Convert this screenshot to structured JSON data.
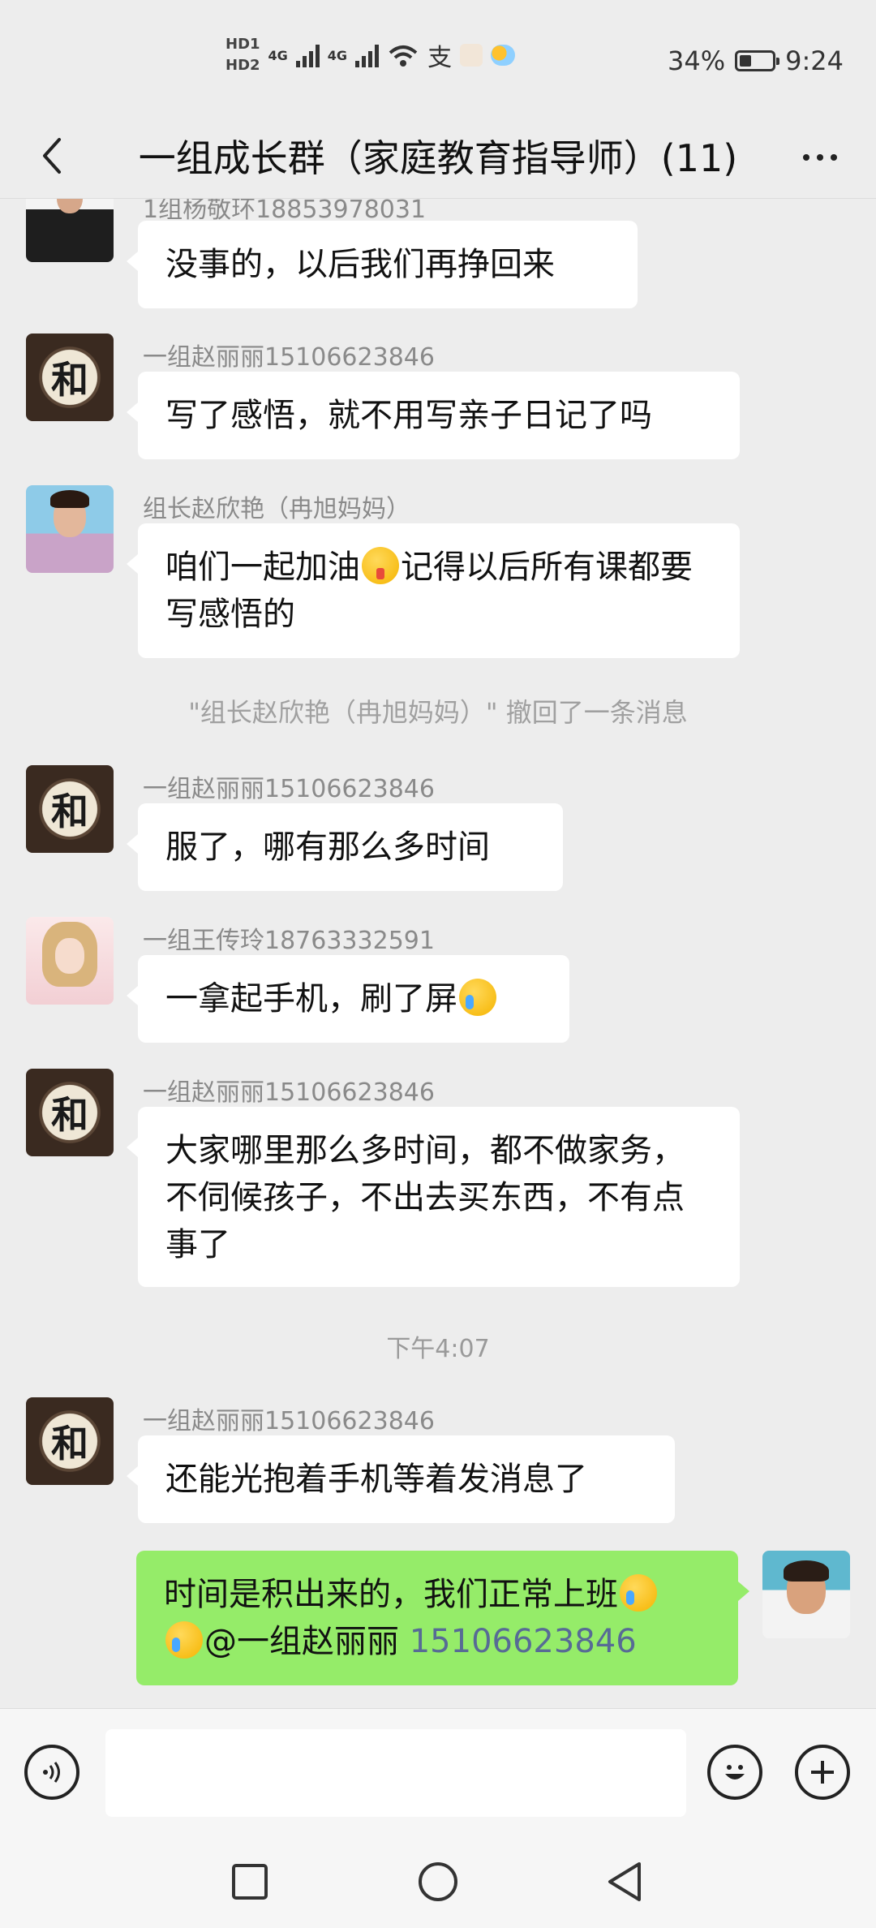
{
  "status_bar": {
    "hd1": "HD1",
    "hd2": "HD2",
    "net1": "4G",
    "net2": "4G",
    "battery": "34%",
    "time": "9:24"
  },
  "header": {
    "title": "一组成长群（家庭教育指导师）(11)"
  },
  "messages": [
    {
      "sender": "1组杨敬环18853978031",
      "text": "没事的，以后我们再挣回来"
    },
    {
      "sender": "一组赵丽丽15106623846",
      "text": "写了感悟，就不用写亲子日记了吗"
    },
    {
      "sender": "组长赵欣艳（冉旭妈妈）",
      "text_a": "咱们一起加油",
      "text_b": "记得以后所有课都要写感悟的"
    },
    {
      "sender": "一组赵丽丽15106623846",
      "text": "服了，哪有那么多时间"
    },
    {
      "sender": "一组王传玲18763332591",
      "text": "一拿起手机，刷了屏"
    },
    {
      "sender": "一组赵丽丽15106623846",
      "text": "大家哪里那么多时间，都不做家务，不伺候孩子，不出去买东西，不有点事了"
    },
    {
      "sender": "一组赵丽丽15106623846",
      "text": "还能光抱着手机等着发消息了"
    }
  ],
  "system_notice": "\"组长赵欣艳（冉旭妈妈）\" 撤回了一条消息",
  "time_divider": "下午4:07",
  "my_message": {
    "text": "时间是积出来的，我们正常上班",
    "mention": "@一组赵丽丽",
    "phone": "15106623846"
  },
  "avatar_glyph": "和",
  "icons": [
    "back-arrow-icon",
    "more-icon",
    "voice-icon",
    "emoji-icon",
    "plus-icon",
    "square-nav-icon",
    "circle-nav-icon",
    "triangle-back-icon"
  ]
}
